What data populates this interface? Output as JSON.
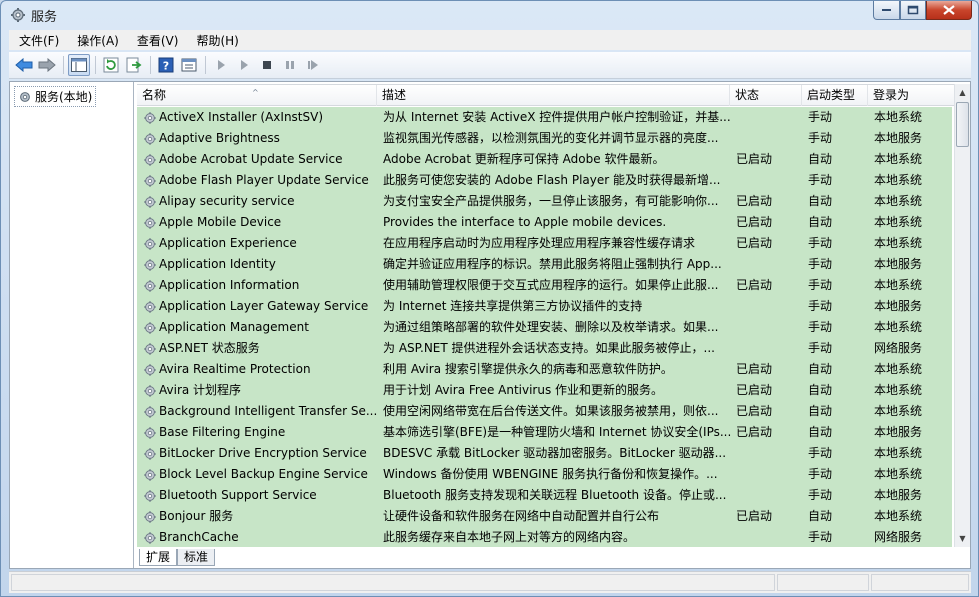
{
  "window": {
    "title": "服务",
    "title_icon": "services-gear-icon"
  },
  "menu": [
    "文件(F)",
    "操作(A)",
    "查看(V)",
    "帮助(H)"
  ],
  "toolbar": {
    "buttons": [
      "back-icon",
      "forward-icon",
      "show-hide-console-tree-icon",
      "refresh-icon",
      "export-list-icon",
      "help-icon",
      "properties-icon",
      "start-service-icon",
      "start-service-alt-icon",
      "stop-service-icon",
      "pause-service-icon",
      "restart-service-icon"
    ]
  },
  "tree": {
    "root_label": "服务(本地)"
  },
  "columns": {
    "name": "名称",
    "description": "描述",
    "status": "状态",
    "startup": "启动类型",
    "logon": "登录为"
  },
  "services": [
    {
      "name": "ActiveX Installer (AxInstSV)",
      "desc": "为从 Internet 安装 ActiveX 控件提供用户帐户控制验证，并基...",
      "status": "",
      "startup": "手动",
      "logon": "本地系统"
    },
    {
      "name": "Adaptive Brightness",
      "desc": "监视氛围光传感器，以检测氛围光的变化并调节显示器的亮度...",
      "status": "",
      "startup": "手动",
      "logon": "本地服务"
    },
    {
      "name": "Adobe Acrobat Update Service",
      "desc": "Adobe Acrobat 更新程序可保持 Adobe 软件最新。",
      "status": "已启动",
      "startup": "自动",
      "logon": "本地系统"
    },
    {
      "name": "Adobe Flash Player Update Service",
      "desc": "此服务可使您安装的 Adobe Flash Player 能及时获得最新增...",
      "status": "",
      "startup": "手动",
      "logon": "本地系统"
    },
    {
      "name": "Alipay security service",
      "desc": "为支付宝安全产品提供服务，一旦停止该服务，有可能影响你...",
      "status": "已启动",
      "startup": "自动",
      "logon": "本地系统"
    },
    {
      "name": "Apple Mobile Device",
      "desc": "Provides the interface to Apple mobile devices.",
      "status": "已启动",
      "startup": "自动",
      "logon": "本地系统"
    },
    {
      "name": "Application Experience",
      "desc": "在应用程序启动时为应用程序处理应用程序兼容性缓存请求",
      "status": "已启动",
      "startup": "手动",
      "logon": "本地系统"
    },
    {
      "name": "Application Identity",
      "desc": "确定并验证应用程序的标识。禁用此服务将阻止强制执行 App...",
      "status": "",
      "startup": "手动",
      "logon": "本地服务"
    },
    {
      "name": "Application Information",
      "desc": "使用辅助管理权限便于交互式应用程序的运行。如果停止此服...",
      "status": "已启动",
      "startup": "手动",
      "logon": "本地系统"
    },
    {
      "name": "Application Layer Gateway Service",
      "desc": "为 Internet 连接共享提供第三方协议插件的支持",
      "status": "",
      "startup": "手动",
      "logon": "本地服务"
    },
    {
      "name": "Application Management",
      "desc": "为通过组策略部署的软件处理安装、删除以及枚举请求。如果...",
      "status": "",
      "startup": "手动",
      "logon": "本地系统"
    },
    {
      "name": "ASP.NET 状态服务",
      "desc": "为 ASP.NET 提供进程外会话状态支持。如果此服务被停止，...",
      "status": "",
      "startup": "手动",
      "logon": "网络服务"
    },
    {
      "name": "Avira Realtime Protection",
      "desc": "利用 Avira 搜索引擎提供永久的病毒和恶意软件防护。",
      "status": "已启动",
      "startup": "自动",
      "logon": "本地系统"
    },
    {
      "name": "Avira 计划程序",
      "desc": "用于计划 Avira Free Antivirus 作业和更新的服务。",
      "status": "已启动",
      "startup": "自动",
      "logon": "本地系统"
    },
    {
      "name": "Background Intelligent Transfer Se...",
      "desc": "使用空闲网络带宽在后台传送文件。如果该服务被禁用，则依...",
      "status": "已启动",
      "startup": "自动",
      "logon": "本地系统"
    },
    {
      "name": "Base Filtering Engine",
      "desc": "基本筛选引擎(BFE)是一种管理防火墙和 Internet 协议安全(IPs...",
      "status": "已启动",
      "startup": "自动",
      "logon": "本地服务"
    },
    {
      "name": "BitLocker Drive Encryption Service",
      "desc": "BDESVC 承载 BitLocker 驱动器加密服务。BitLocker 驱动器...",
      "status": "",
      "startup": "手动",
      "logon": "本地系统"
    },
    {
      "name": "Block Level Backup Engine Service",
      "desc": "Windows 备份使用 WBENGINE 服务执行备份和恢复操作。...",
      "status": "",
      "startup": "手动",
      "logon": "本地系统"
    },
    {
      "name": "Bluetooth Support Service",
      "desc": "Bluetooth 服务支持发现和关联远程 Bluetooth 设备。停止或...",
      "status": "",
      "startup": "手动",
      "logon": "本地服务"
    },
    {
      "name": "Bonjour 服务",
      "desc": "让硬件设备和软件服务在网络中自动配置并自行公布",
      "status": "已启动",
      "startup": "自动",
      "logon": "本地系统"
    },
    {
      "name": "BranchCache",
      "desc": "此服务缓存来自本地子网上对等方的网络内容。",
      "status": "",
      "startup": "手动",
      "logon": "网络服务"
    }
  ],
  "tabs": [
    "扩展",
    "标准"
  ],
  "row_color": "#c7e5c7"
}
